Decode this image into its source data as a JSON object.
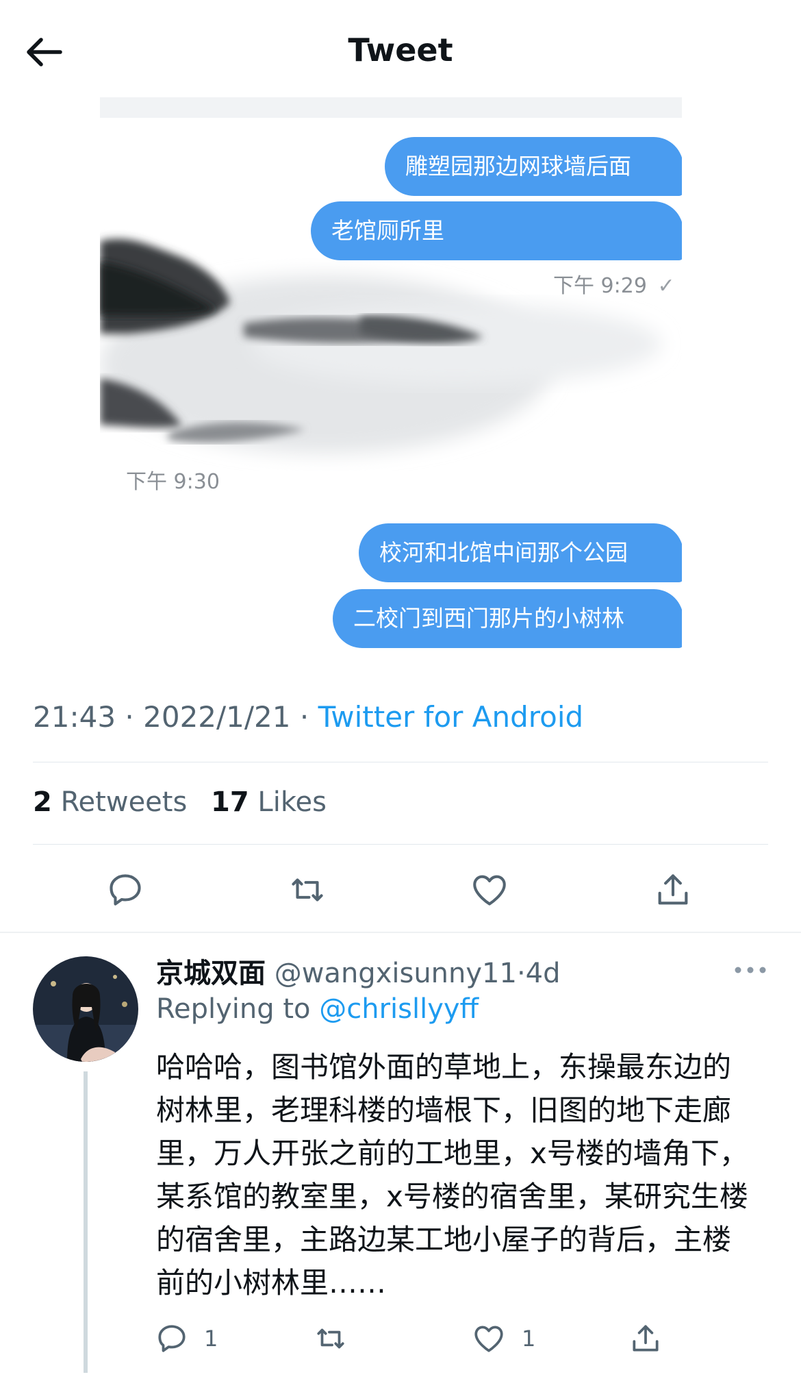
{
  "header": {
    "title": "Tweet"
  },
  "chat_image": {
    "outgoing_1": [
      "雕塑园那边网球墙后面",
      "老馆厕所里"
    ],
    "time_1": "下午 9:29",
    "time_2": "下午 9:30",
    "outgoing_2": [
      "校河和北馆中间那个公园",
      "二校门到西门那片的小树林"
    ]
  },
  "tweet_meta": {
    "time": "21:43",
    "date": "2022/1/21",
    "source": "Twitter for Android",
    "separator": "·"
  },
  "stats": {
    "retweets_count": "2",
    "retweets_label": "Retweets",
    "likes_count": "17",
    "likes_label": "Likes"
  },
  "reply": {
    "name": "京城双面",
    "handle": "@wangxisunny11",
    "time": "4d",
    "replying_label": "Replying to",
    "replying_to": "@chrisllyyff",
    "text": "哈哈哈，图书馆外面的草地上，东操最东边的树林里，老理科楼的墙根下，旧图的地下走廊里，万人开张之前的工地里，x号楼的墙角下，某系馆的教室里，x号楼的宿舍里，某研究生楼的宿舍里，主路边某工地小屋子的背后，主楼前的小树林里……",
    "reply_count": "1",
    "like_count": "1"
  },
  "colors": {
    "accent": "#1d9bf0",
    "bubble": "#4a9cf0",
    "secondary_text": "#536471"
  }
}
